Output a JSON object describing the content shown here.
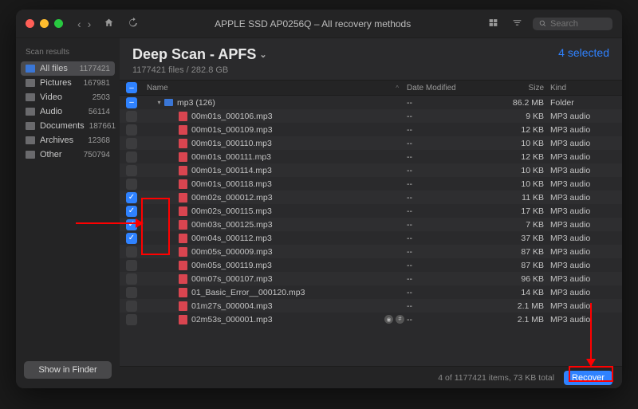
{
  "titlebar": {
    "title": "APPLE SSD AP0256Q – All recovery methods",
    "search_placeholder": "Search"
  },
  "sidebar": {
    "heading": "Scan results",
    "items": [
      {
        "label": "All files",
        "count": "1177421",
        "icon": "folder",
        "active": true
      },
      {
        "label": "Pictures",
        "count": "167981",
        "icon": "pic"
      },
      {
        "label": "Video",
        "count": "2503",
        "icon": "pic"
      },
      {
        "label": "Audio",
        "count": "56114",
        "icon": "pic"
      },
      {
        "label": "Documents",
        "count": "187661",
        "icon": "pic"
      },
      {
        "label": "Archives",
        "count": "12368",
        "icon": "pic"
      },
      {
        "label": "Other",
        "count": "750794",
        "icon": "pic"
      }
    ],
    "finder_button": "Show in Finder"
  },
  "header": {
    "title": "Deep Scan - APFS",
    "subtitle": "1177421 files / 282.8 GB",
    "selected_text": "4 selected"
  },
  "columns": {
    "name": "Name",
    "date": "Date Modified",
    "size": "Size",
    "kind": "Kind"
  },
  "rows": [
    {
      "cb": "dash",
      "indent": 0,
      "disc": "down",
      "icon": "folder",
      "name": "mp3 (126)",
      "date": "--",
      "size": "86.2 MB",
      "kind": "Folder"
    },
    {
      "cb": "",
      "indent": 1,
      "disc": "",
      "icon": "audio",
      "name": "00m01s_000106.mp3",
      "date": "--",
      "size": "9 KB",
      "kind": "MP3 audio"
    },
    {
      "cb": "",
      "indent": 1,
      "disc": "",
      "icon": "audio",
      "name": "00m01s_000109.mp3",
      "date": "--",
      "size": "12 KB",
      "kind": "MP3 audio"
    },
    {
      "cb": "",
      "indent": 1,
      "disc": "",
      "icon": "audio",
      "name": "00m01s_000110.mp3",
      "date": "--",
      "size": "10 KB",
      "kind": "MP3 audio"
    },
    {
      "cb": "",
      "indent": 1,
      "disc": "",
      "icon": "audio",
      "name": "00m01s_000111.mp3",
      "date": "--",
      "size": "12 KB",
      "kind": "MP3 audio"
    },
    {
      "cb": "",
      "indent": 1,
      "disc": "",
      "icon": "audio",
      "name": "00m01s_000114.mp3",
      "date": "--",
      "size": "10 KB",
      "kind": "MP3 audio"
    },
    {
      "cb": "",
      "indent": 1,
      "disc": "",
      "icon": "audio",
      "name": "00m01s_000118.mp3",
      "date": "--",
      "size": "10 KB",
      "kind": "MP3 audio"
    },
    {
      "cb": "checked",
      "indent": 1,
      "disc": "",
      "icon": "audio",
      "name": "00m02s_000012.mp3",
      "date": "--",
      "size": "11 KB",
      "kind": "MP3 audio"
    },
    {
      "cb": "checked",
      "indent": 1,
      "disc": "",
      "icon": "audio",
      "name": "00m02s_000115.mp3",
      "date": "--",
      "size": "17 KB",
      "kind": "MP3 audio"
    },
    {
      "cb": "checked",
      "indent": 1,
      "disc": "",
      "icon": "audio",
      "name": "00m03s_000125.mp3",
      "date": "--",
      "size": "7 KB",
      "kind": "MP3 audio"
    },
    {
      "cb": "checked",
      "indent": 1,
      "disc": "",
      "icon": "audio",
      "name": "00m04s_000112.mp3",
      "date": "--",
      "size": "37 KB",
      "kind": "MP3 audio"
    },
    {
      "cb": "",
      "indent": 1,
      "disc": "",
      "icon": "audio",
      "name": "00m05s_000009.mp3",
      "date": "--",
      "size": "87 KB",
      "kind": "MP3 audio"
    },
    {
      "cb": "",
      "indent": 1,
      "disc": "",
      "icon": "audio",
      "name": "00m05s_000119.mp3",
      "date": "--",
      "size": "87 KB",
      "kind": "MP3 audio"
    },
    {
      "cb": "",
      "indent": 1,
      "disc": "",
      "icon": "audio",
      "name": "00m07s_000107.mp3",
      "date": "--",
      "size": "96 KB",
      "kind": "MP3 audio"
    },
    {
      "cb": "",
      "indent": 1,
      "disc": "",
      "icon": "audio",
      "name": "01_Basic_Error__000120.mp3",
      "date": "--",
      "size": "14 KB",
      "kind": "MP3 audio"
    },
    {
      "cb": "",
      "indent": 1,
      "disc": "",
      "icon": "audio",
      "name": "01m27s_000004.mp3",
      "date": "--",
      "size": "2.1 MB",
      "kind": "MP3 audio"
    },
    {
      "cb": "",
      "indent": 1,
      "disc": "",
      "icon": "audio",
      "name": "02m53s_000001.mp3",
      "date": "--",
      "size": "2.1 MB",
      "kind": "MP3 audio",
      "badges": true
    }
  ],
  "footer": {
    "summary": "4 of 1177421 items, 73 KB total",
    "recover_label": "Recover"
  }
}
